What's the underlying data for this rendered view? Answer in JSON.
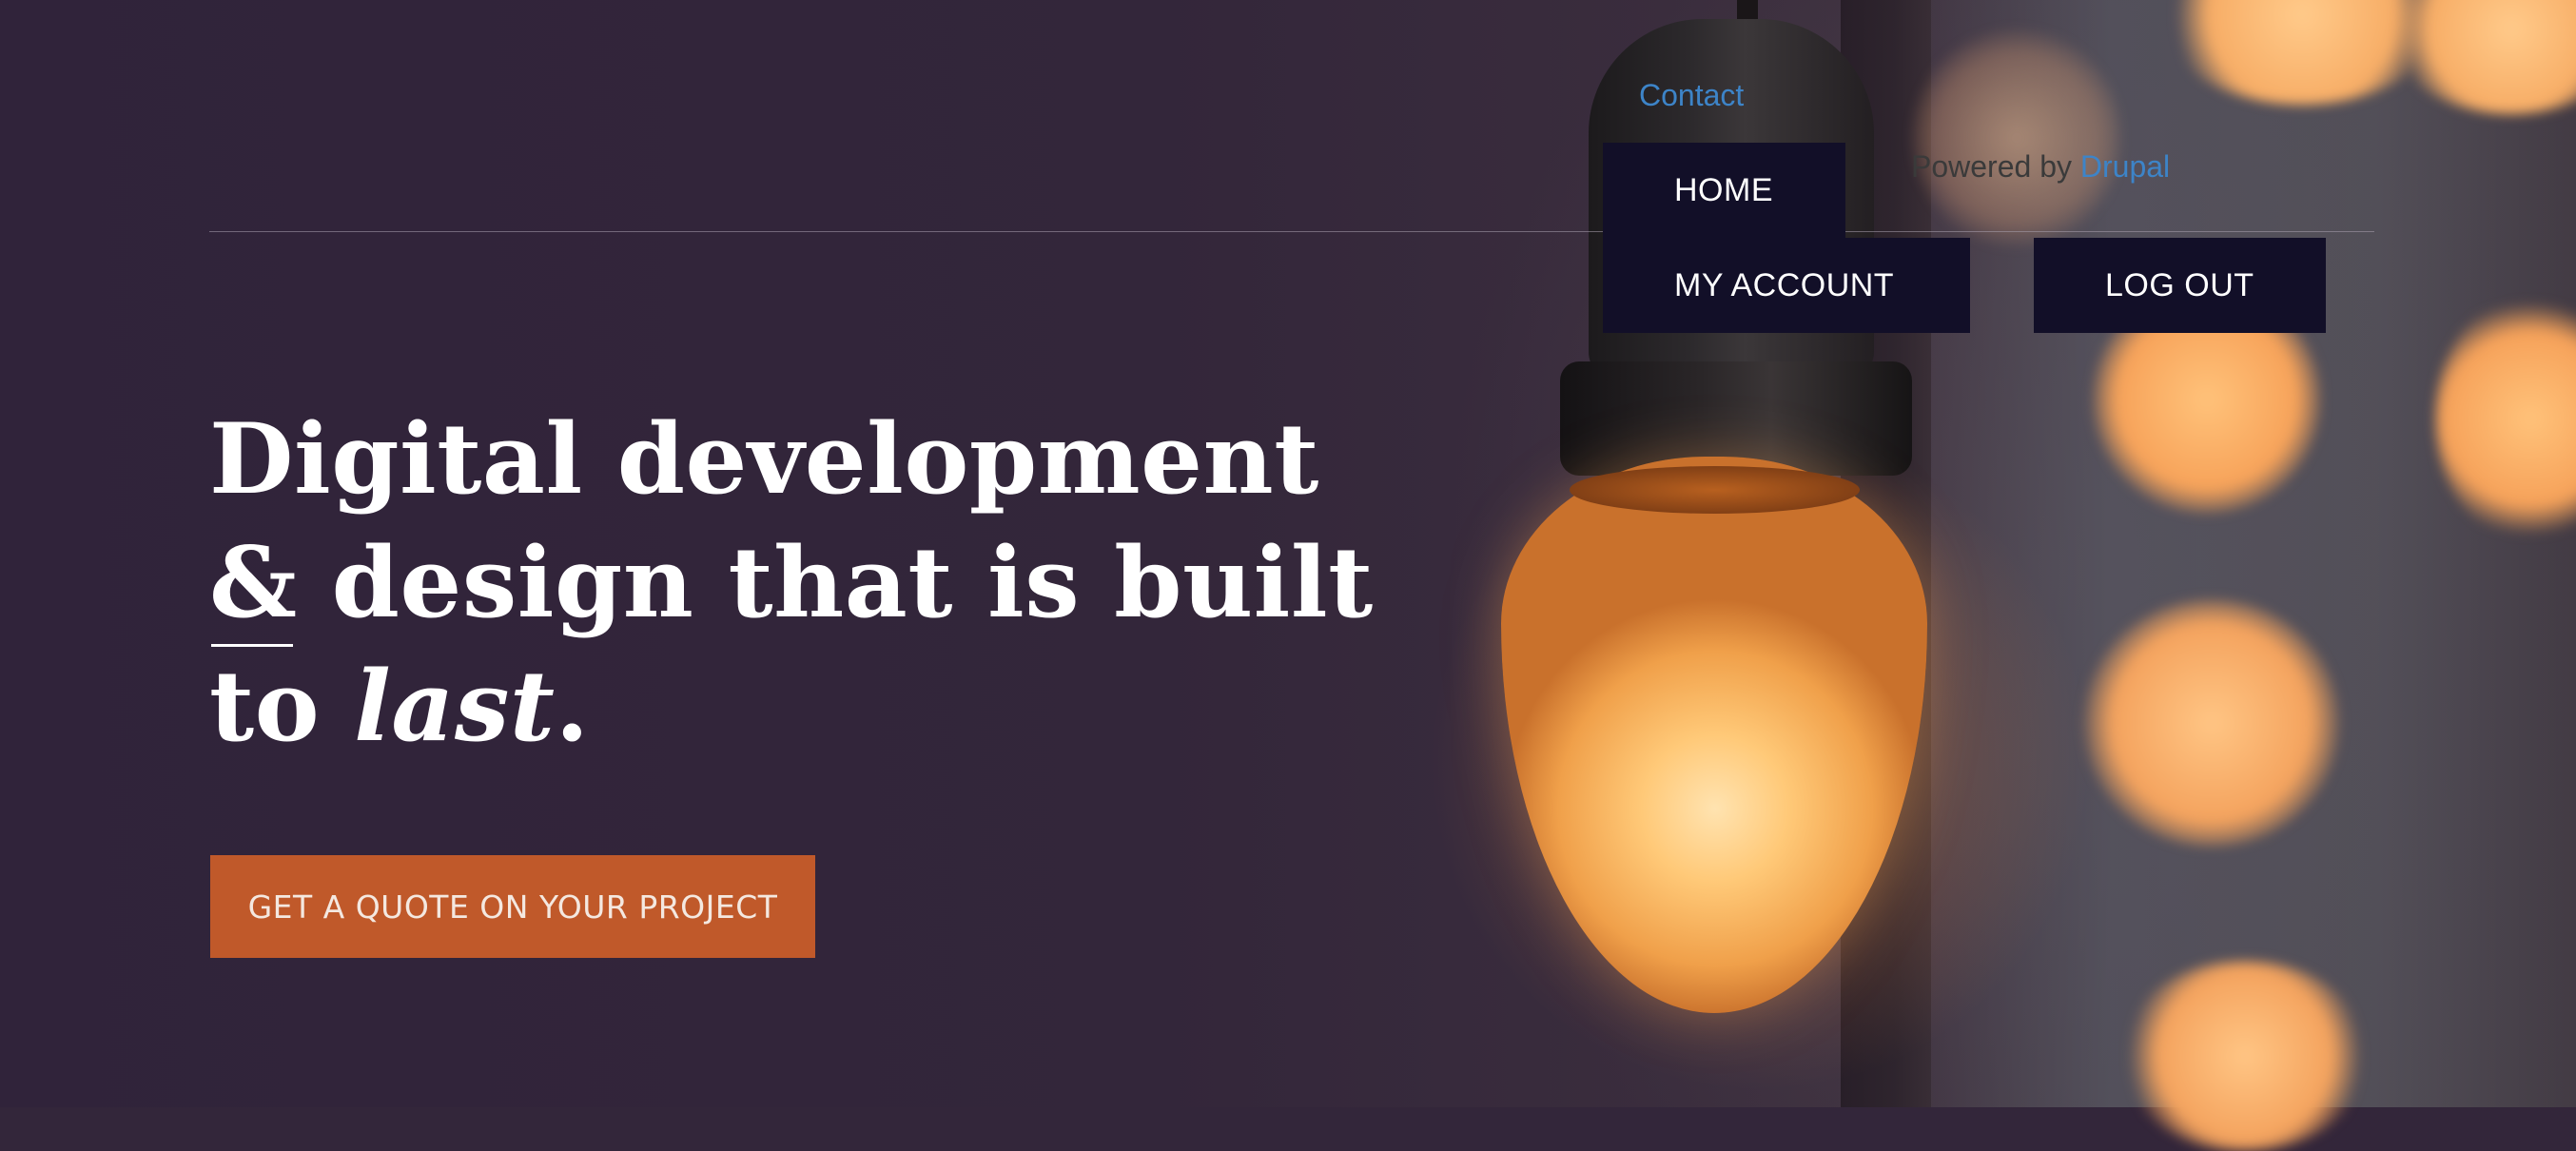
{
  "header": {
    "contact_label": "Contact",
    "powered_prefix": "Powered by ",
    "powered_link": "Drupal"
  },
  "nav": {
    "items": [
      {
        "label": "HOME"
      },
      {
        "label": "MY ACCOUNT"
      },
      {
        "label": "LOG OUT"
      }
    ]
  },
  "hero": {
    "headline_line1": "Digital development",
    "headline_line2": "& design that is built",
    "headline_line3_prefix": "to ",
    "headline_line3_emphasis": "last",
    "headline_line3_suffix": ".",
    "cta_label": "GET A QUOTE ON YOUR PROJECT"
  },
  "colors": {
    "link": "#3d84c8",
    "nav_background": "#120f28",
    "cta_background": "#c0592a",
    "hero_background": "#33263a"
  },
  "icons": {
    "background": "lightbulb-photo"
  }
}
